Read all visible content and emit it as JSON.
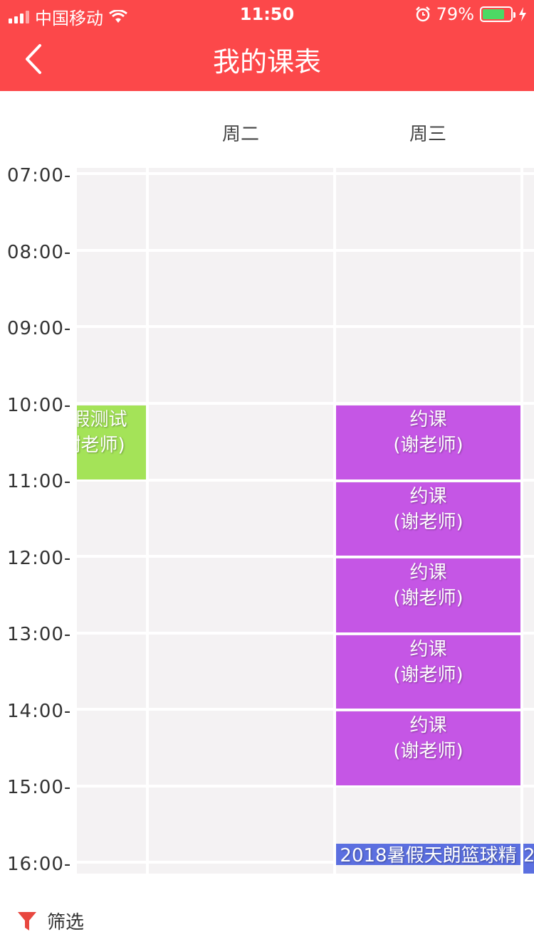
{
  "status_bar": {
    "carrier": "中国移动",
    "time": "11:50",
    "battery": "79%",
    "battery_level": 0.79
  },
  "nav": {
    "title": "我的课表"
  },
  "days": [
    "周二",
    "周三"
  ],
  "times": [
    "07:00-",
    "08:00-",
    "09:00-",
    "10:00-",
    "11:00-",
    "12:00-",
    "13:00-",
    "14:00-",
    "15:00-",
    "16:00-"
  ],
  "events": [
    {
      "title": "请假测试",
      "teacher": "(谢老师)",
      "color": "#a4e358"
    },
    {
      "title": "约课",
      "teacher": "(谢老师)",
      "color": "#c556e5"
    },
    {
      "title": "约课",
      "teacher": "(谢老师)",
      "color": "#c556e5"
    },
    {
      "title": "约课",
      "teacher": "(谢老师)",
      "color": "#c556e5"
    },
    {
      "title": "约课",
      "teacher": "(谢老师)",
      "color": "#c556e5"
    },
    {
      "title": "约课",
      "teacher": "(谢老师)",
      "color": "#c556e5"
    },
    {
      "title": "2018暑假天朗篮球精",
      "color": "#5b6fe0"
    },
    {
      "title": "2",
      "color": "#5b6fe0"
    }
  ],
  "filter": {
    "label": "筛选",
    "color": "#e8473f"
  },
  "colors": {
    "accent": "#fc484a",
    "grid": "#f4f2f3"
  }
}
